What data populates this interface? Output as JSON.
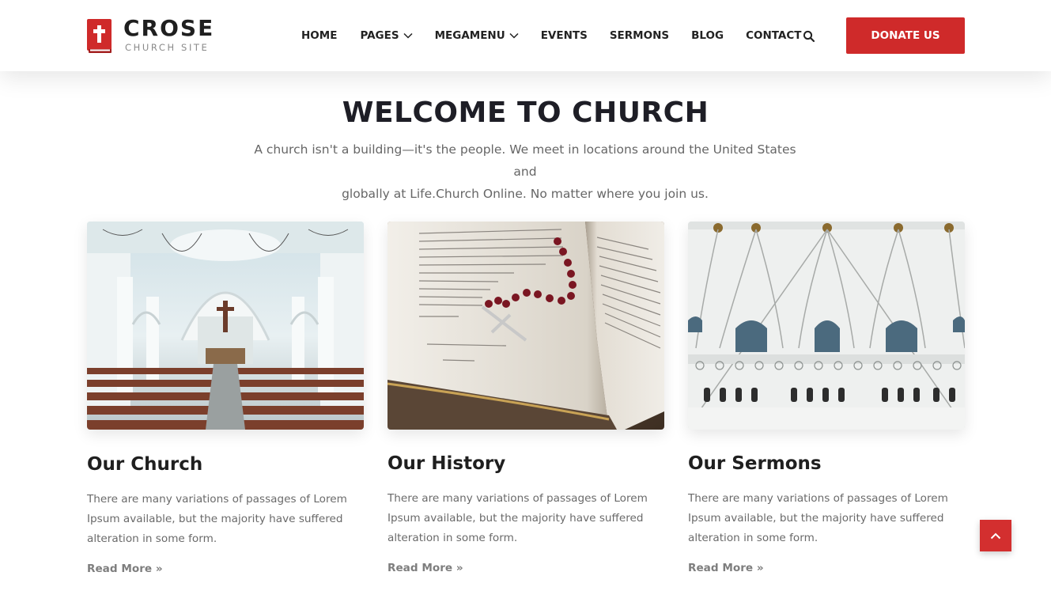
{
  "brand": {
    "name": "CROSE",
    "tagline": "CHURCH SITE",
    "icon": "bible-cross-icon",
    "color": "#cf2a2a"
  },
  "nav": {
    "items": [
      {
        "label": "HOME",
        "dropdown": false
      },
      {
        "label": "PAGES",
        "dropdown": true
      },
      {
        "label": "MEGAMENU",
        "dropdown": true
      },
      {
        "label": "EVENTS",
        "dropdown": false
      },
      {
        "label": "SERMONS",
        "dropdown": false
      },
      {
        "label": "BLOG",
        "dropdown": false
      },
      {
        "label": "CONTACT",
        "dropdown": false
      }
    ],
    "search_icon": "search-icon",
    "donate_label": "DONATE US"
  },
  "welcome": {
    "title": "WELCOME TO CHURCH",
    "text_line1": "A church isn't a building—it's the people. We meet in locations around the United States and",
    "text_line2": "globally at Life.Church Online. No matter where you join us."
  },
  "cards": [
    {
      "title": "Our Church",
      "text_lines": [
        "There are many variations of passages of Lorem",
        "Ipsum available, but the majority have suffered",
        "alteration in some form."
      ],
      "link": "Read More",
      "image": "church-interior-photo"
    },
    {
      "title": "Our History",
      "text_lines": [
        "There are many variations of passages of Lorem",
        "Ipsum available, but the majority have suffered",
        "alteration in some form."
      ],
      "link": "Read More",
      "image": "open-bible-rosary-photo"
    },
    {
      "title": "Our Sermons",
      "text_lines": [
        "There are many variations of passages of Lorem",
        "Ipsum available, but the majority have suffered",
        "alteration in some form."
      ],
      "link": "Read More",
      "image": "church-ceiling-photo"
    }
  ],
  "back_to_top_icon": "chevron-up-icon",
  "colors": {
    "accent": "#cf2a2a",
    "heading": "#1e1e26",
    "body_text": "#666666"
  }
}
